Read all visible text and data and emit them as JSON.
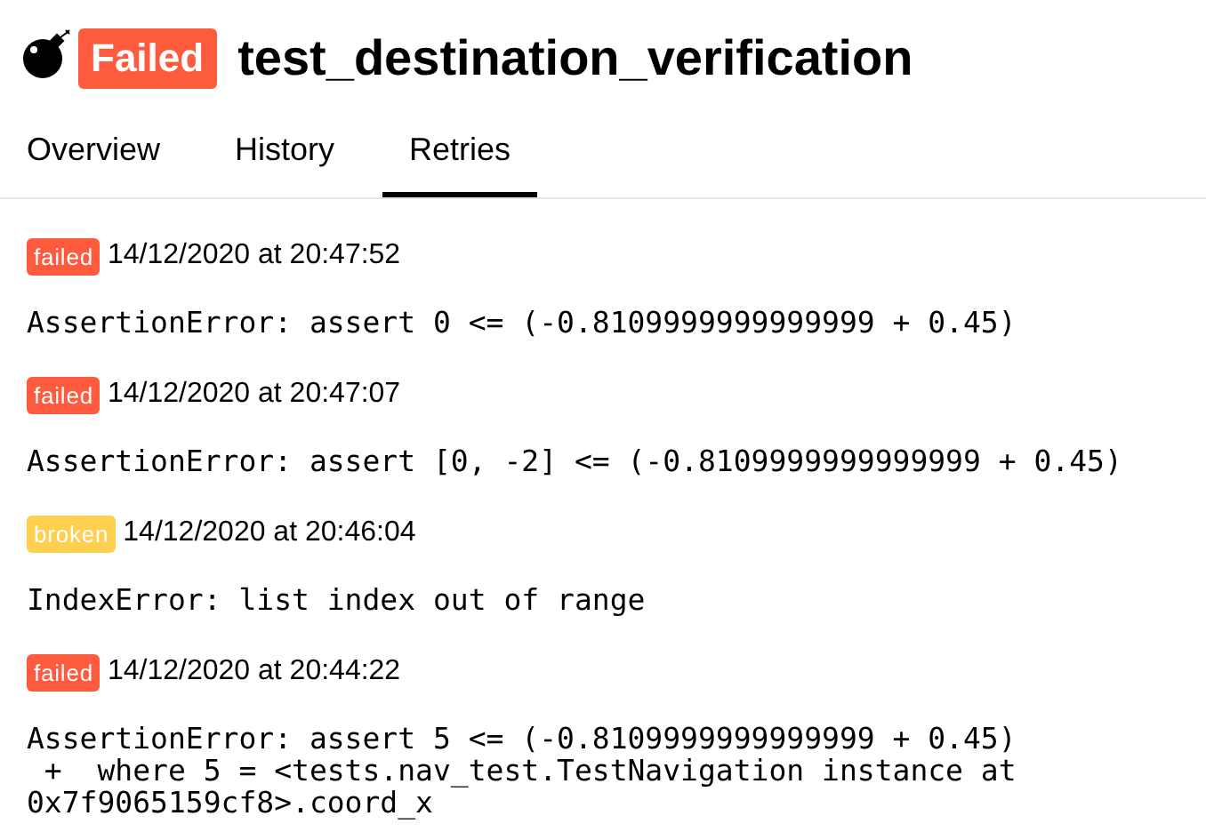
{
  "header": {
    "status": "Failed",
    "color": "#fd5a3e",
    "title": "test_destination_verification"
  },
  "tabs": [
    {
      "label": "Overview",
      "selected": false
    },
    {
      "label": "History",
      "selected": false
    },
    {
      "label": "Retries",
      "selected": true
    }
  ],
  "retries": [
    {
      "status": "failed",
      "kind": "failed",
      "time": "14/12/2020 at 20:47:52",
      "message": [
        "AssertionError: assert 0 <= (-0.8109999999999999 + 0.45)"
      ]
    },
    {
      "status": "failed",
      "kind": "failed",
      "time": "14/12/2020 at 20:47:07",
      "message": [
        "AssertionError: assert [0, -2] <= (-0.8109999999999999 + 0.45)"
      ]
    },
    {
      "status": "broken",
      "kind": "broken",
      "time": "14/12/2020 at 20:46:04",
      "message": [
        "IndexError: list index out of range"
      ]
    },
    {
      "status": "failed",
      "kind": "failed",
      "time": "14/12/2020 at 20:44:22",
      "message": [
        "AssertionError: assert 5 <= (-0.8109999999999999 + 0.45)",
        " +  where 5 = <tests.nav_test.TestNavigation instance at",
        "0x7f9065159cf8>.coord_x"
      ]
    }
  ]
}
